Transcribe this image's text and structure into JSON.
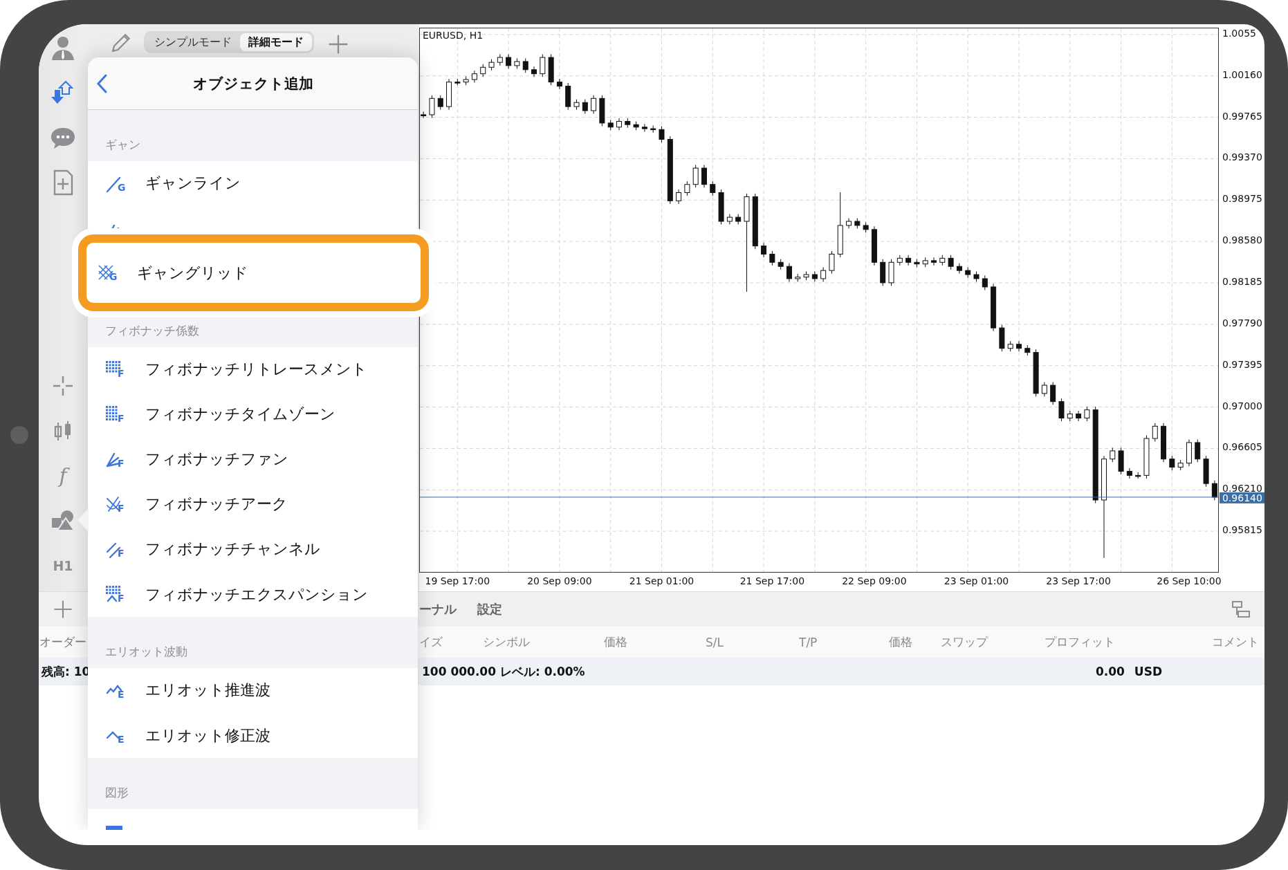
{
  "sidebar": {
    "function_glyph": "f",
    "timeframe": "H1"
  },
  "mode_tabs": [
    {
      "label": "シンプルモード",
      "selected": false
    },
    {
      "label": "詳細モード",
      "selected": true
    }
  ],
  "chart": {
    "chart_data": {
      "type": "candlestick",
      "title": "EURUSD, H1",
      "grid": true,
      "ylim": [
        0.9542,
        1.0062
      ],
      "yticks": [
        {
          "value": 1.00555,
          "label": "1.0055"
        },
        {
          "value": 1.0016,
          "label": "1.00160"
        },
        {
          "value": 0.99765,
          "label": "0.99765"
        },
        {
          "value": 0.9937,
          "label": "0.99370"
        },
        {
          "value": 0.98975,
          "label": "0.98975"
        },
        {
          "value": 0.9858,
          "label": "0.98580"
        },
        {
          "value": 0.98185,
          "label": "0.98185"
        },
        {
          "value": 0.9779,
          "label": "0.97790"
        },
        {
          "value": 0.97395,
          "label": "0.97395"
        },
        {
          "value": 0.97,
          "label": "0.97000"
        },
        {
          "value": 0.96605,
          "label": "0.96605"
        },
        {
          "value": 0.9621,
          "label": "0.96210"
        },
        {
          "value": 0.95815,
          "label": "0.95815"
        }
      ],
      "categories": [
        null,
        null,
        null,
        null,
        "19 Sep 17:00",
        null,
        null,
        null,
        null,
        null,
        null,
        null,
        null,
        null,
        null,
        null,
        "20 Sep 09:00",
        null,
        null,
        null,
        null,
        null,
        null,
        null,
        null,
        null,
        null,
        null,
        "21 Sep 01:00",
        null,
        null,
        null,
        null,
        null,
        null,
        null,
        null,
        null,
        null,
        null,
        null,
        "21 Sep 17:00",
        null,
        null,
        null,
        null,
        null,
        null,
        null,
        null,
        null,
        null,
        null,
        "22 Sep 09:00",
        null,
        null,
        null,
        null,
        null,
        null,
        null,
        null,
        null,
        null,
        null,
        "23 Sep 01:00",
        null,
        null,
        null,
        null,
        null,
        null,
        null,
        null,
        null,
        null,
        null,
        "23 Sep 17:00",
        null,
        null,
        null,
        null,
        null,
        null,
        null,
        null,
        null,
        null,
        null,
        null,
        "26 Sep 10:00",
        null,
        null,
        null
      ],
      "ohlc": [
        [
          0.99789,
          0.99819,
          0.99759,
          0.99789
        ],
        [
          0.99789,
          0.99975,
          0.99759,
          0.99945
        ],
        [
          0.99945,
          0.99975,
          0.99837,
          0.99867
        ],
        [
          0.99867,
          1.00131,
          0.99837,
          1.00101
        ],
        [
          1.00101,
          1.00131,
          1.00071,
          1.00101
        ],
        [
          1.00101,
          1.00155,
          1.00071,
          1.00125
        ],
        [
          1.00125,
          1.0021,
          1.00095,
          1.0018
        ],
        [
          1.0018,
          1.00272,
          1.0015,
          1.00242
        ],
        [
          1.00242,
          1.00319,
          1.00212,
          1.00289
        ],
        [
          1.00289,
          1.00366,
          1.00259,
          1.00336
        ],
        [
          1.00336,
          1.00366,
          1.00228,
          1.00258
        ],
        [
          1.00258,
          1.00327,
          1.00228,
          1.00297
        ],
        [
          1.00297,
          1.00327,
          1.00189,
          1.00219
        ],
        [
          1.00219,
          1.00249,
          1.0015,
          1.0018
        ],
        [
          1.0018,
          1.00366,
          1.0015,
          1.00336
        ],
        [
          1.00336,
          1.00366,
          1.00071,
          1.00101
        ],
        [
          1.00101,
          1.00131,
          1.00032,
          1.00062
        ],
        [
          1.00062,
          1.00092,
          0.99837,
          0.99867
        ],
        [
          0.99867,
          0.99936,
          0.99837,
          0.99906
        ],
        [
          0.99906,
          0.99936,
          0.99798,
          0.99828
        ],
        [
          0.99828,
          0.99975,
          0.99798,
          0.99945
        ],
        [
          0.99945,
          0.99975,
          0.9968,
          0.9971
        ],
        [
          0.9971,
          0.9974,
          0.99641,
          0.99671
        ],
        [
          0.99671,
          0.99756,
          0.99641,
          0.99726
        ],
        [
          0.99726,
          0.99756,
          0.99665,
          0.99695
        ],
        [
          0.99695,
          0.99725,
          0.99641,
          0.99671
        ],
        [
          0.99671,
          0.99701,
          0.99626,
          0.99656
        ],
        [
          0.99656,
          0.99686,
          0.99618,
          0.99648
        ],
        [
          0.99648,
          0.99678,
          0.99524,
          0.99554
        ],
        [
          0.99554,
          0.99584,
          0.98938,
          0.98968
        ],
        [
          0.98968,
          0.99076,
          0.98938,
          0.99046
        ],
        [
          0.99046,
          0.99154,
          0.99016,
          0.99124
        ],
        [
          0.99124,
          0.9931,
          0.99094,
          0.9928
        ],
        [
          0.9928,
          0.9931,
          0.99094,
          0.99124
        ],
        [
          0.99124,
          0.99154,
          0.99016,
          0.99046
        ],
        [
          0.99046,
          0.99076,
          0.98742,
          0.98772
        ],
        [
          0.98772,
          0.98841,
          0.98742,
          0.98811
        ],
        [
          0.98811,
          0.98841,
          0.98742,
          0.98772
        ],
        [
          0.98772,
          0.99037,
          0.981,
          0.99007
        ],
        [
          0.99007,
          0.99037,
          0.98507,
          0.98537
        ],
        [
          0.98537,
          0.98567,
          0.98429,
          0.98459
        ],
        [
          0.98459,
          0.98489,
          0.98351,
          0.98381
        ],
        [
          0.98381,
          0.98411,
          0.98312,
          0.98342
        ],
        [
          0.98342,
          0.98372,
          0.98195,
          0.98225
        ],
        [
          0.98225,
          0.9827,
          0.98195,
          0.9824
        ],
        [
          0.9824,
          0.98294,
          0.9821,
          0.98264
        ],
        [
          0.98264,
          0.98294,
          0.98195,
          0.98225
        ],
        [
          0.98225,
          0.98333,
          0.98195,
          0.98303
        ],
        [
          0.98303,
          0.98489,
          0.98273,
          0.98459
        ],
        [
          0.98459,
          0.9905,
          0.98429,
          0.98733
        ],
        [
          0.98733,
          0.98802,
          0.98703,
          0.98772
        ],
        [
          0.98772,
          0.98802,
          0.98703,
          0.98733
        ],
        [
          0.98733,
          0.98763,
          0.98664,
          0.98694
        ],
        [
          0.98694,
          0.98724,
          0.98351,
          0.98381
        ],
        [
          0.98381,
          0.98411,
          0.98156,
          0.98186
        ],
        [
          0.98186,
          0.98411,
          0.98156,
          0.98381
        ],
        [
          0.98381,
          0.9845,
          0.98351,
          0.9842
        ],
        [
          0.9842,
          0.9845,
          0.98351,
          0.98381
        ],
        [
          0.98381,
          0.98411,
          0.98335,
          0.98365
        ],
        [
          0.98365,
          0.98427,
          0.98335,
          0.98397
        ],
        [
          0.98397,
          0.98427,
          0.98351,
          0.98381
        ],
        [
          0.98381,
          0.9845,
          0.98351,
          0.9842
        ],
        [
          0.9842,
          0.9845,
          0.98312,
          0.98342
        ],
        [
          0.98342,
          0.98372,
          0.98273,
          0.98303
        ],
        [
          0.98303,
          0.98333,
          0.98234,
          0.98264
        ],
        [
          0.98264,
          0.98294,
          0.98195,
          0.98225
        ],
        [
          0.98225,
          0.98255,
          0.98116,
          0.98146
        ],
        [
          0.98146,
          0.98176,
          0.97725,
          0.97755
        ],
        [
          0.97755,
          0.97785,
          0.9753,
          0.9756
        ],
        [
          0.9756,
          0.97629,
          0.9753,
          0.97599
        ],
        [
          0.97599,
          0.97629,
          0.9753,
          0.9756
        ],
        [
          0.9756,
          0.9759,
          0.97491,
          0.97521
        ],
        [
          0.97521,
          0.97551,
          0.971,
          0.9713
        ],
        [
          0.9713,
          0.97238,
          0.971,
          0.97208
        ],
        [
          0.97208,
          0.97238,
          0.97022,
          0.97052
        ],
        [
          0.97052,
          0.97082,
          0.96865,
          0.96895
        ],
        [
          0.96895,
          0.96964,
          0.96865,
          0.96934
        ],
        [
          0.96934,
          0.96964,
          0.96865,
          0.96895
        ],
        [
          0.96895,
          0.97003,
          0.96865,
          0.96973
        ],
        [
          0.96973,
          0.97003,
          0.96083,
          0.96113
        ],
        [
          0.96113,
          0.96534,
          0.9556,
          0.96504
        ],
        [
          0.96504,
          0.96612,
          0.96474,
          0.96582
        ],
        [
          0.96582,
          0.96612,
          0.96357,
          0.96387
        ],
        [
          0.96387,
          0.96417,
          0.96318,
          0.96348
        ],
        [
          0.96348,
          0.96378,
          0.96318,
          0.96348
        ],
        [
          0.96348,
          0.9673,
          0.96318,
          0.967
        ],
        [
          0.967,
          0.96847,
          0.9667,
          0.96817
        ],
        [
          0.96817,
          0.96847,
          0.96474,
          0.96504
        ],
        [
          0.96504,
          0.96534,
          0.96396,
          0.96426
        ],
        [
          0.96426,
          0.96495,
          0.96396,
          0.96465
        ],
        [
          0.96465,
          0.96691,
          0.96435,
          0.96661
        ],
        [
          0.96661,
          0.96691,
          0.96474,
          0.96504
        ],
        [
          0.96504,
          0.96534,
          0.9624,
          0.9627
        ],
        [
          0.9627,
          0.963,
          0.9611,
          0.9614
        ]
      ],
      "ref_lines": [
        {
          "axis": "y",
          "value": 0.9614,
          "label": "0.96140",
          "color": "#3a6ea5"
        }
      ]
    }
  },
  "popover": {
    "title": "オブジェクト追加",
    "sections": [
      {
        "header": "ギャン",
        "items": [
          {
            "kind": "gann-line",
            "label": "ギャンライン",
            "icon_letter": "G",
            "highlighted": false
          },
          {
            "kind": "gann-fan",
            "highlighted": false
          },
          {
            "kind": "gann-grid",
            "label": "ギャングリッド",
            "icon_letter": "G",
            "highlighted": true
          }
        ]
      },
      {
        "header": "フィボナッチ係数",
        "items": [
          {
            "kind": "fib-retracement",
            "label": "フィボナッチリトレースメント",
            "icon_letter": "F",
            "highlighted": false
          },
          {
            "kind": "fib-timezones",
            "label": "フィボナッチタイムゾーン",
            "icon_letter": "F",
            "highlighted": false
          },
          {
            "kind": "fib-fan",
            "label": "フィボナッチファン",
            "icon_letter": "F",
            "highlighted": false
          },
          {
            "kind": "fib-arc",
            "label": "フィボナッチアーク",
            "icon_letter": "F",
            "highlighted": false
          },
          {
            "kind": "fib-channel",
            "label": "フィボナッチチャンネル",
            "icon_letter": "F",
            "highlighted": false
          },
          {
            "kind": "fib-expansion",
            "label": "フィボナッチエクスパンション",
            "icon_letter": "F",
            "highlighted": false
          }
        ]
      },
      {
        "header": "エリオット波動",
        "items": [
          {
            "kind": "elliott-impulse",
            "label": "エリオット推進波",
            "icon_letter": "E",
            "highlighted": false
          },
          {
            "kind": "elliott-correction",
            "label": "エリオット修正波",
            "icon_letter": "E",
            "highlighted": false
          }
        ]
      },
      {
        "header": "図形",
        "items": [
          {
            "kind": "rectangle",
            "highlighted": false
          }
        ]
      }
    ]
  },
  "terminal": {
    "tabs": [
      "ーナル",
      "設定"
    ],
    "row_header": "オーダー",
    "columns": [
      "イズ",
      "シンボル",
      "価格",
      "S/L",
      "T/P",
      "価格",
      "スワップ",
      "プロフィット",
      "コメント"
    ],
    "balance": {
      "label": "残高: 10",
      "summary": "100 000.00 レベル: 0.00%",
      "profit": "0.00",
      "currency": "USD"
    }
  }
}
